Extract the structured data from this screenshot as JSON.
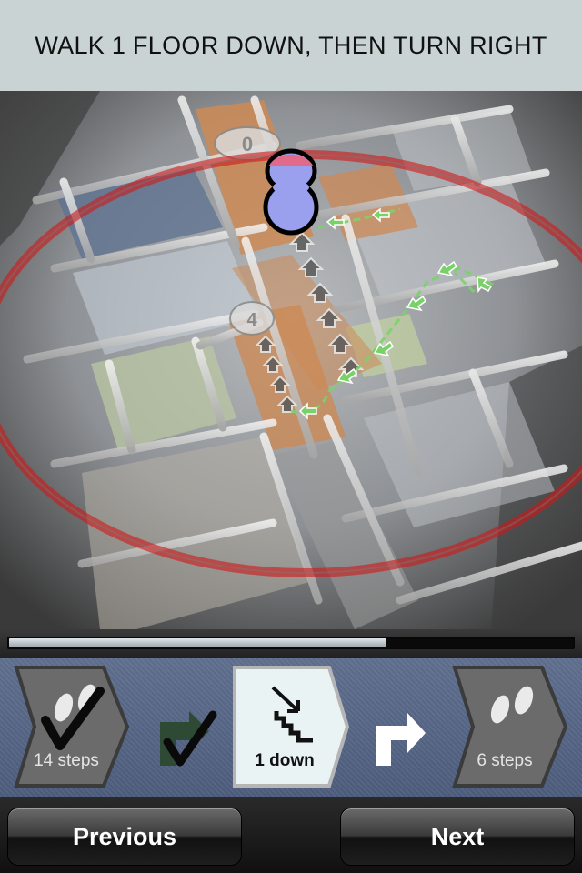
{
  "header": {
    "instruction": "WALK 1 FLOOR DOWN, THEN TURN RIGHT"
  },
  "map": {
    "room_numbers": [
      "0",
      "4"
    ],
    "colors": {
      "corridor": "#cc8a55",
      "route_to_do": "#6a6a6a",
      "route_other": "#7ad16a",
      "user_marker": "#9aa0ee",
      "range_ring": "#d01818"
    }
  },
  "progress": {
    "value": 0.67
  },
  "steps": [
    {
      "label": "14 steps",
      "icon": "footprints-icon",
      "completed": true
    },
    {
      "label": "",
      "icon": "turn-left-arrow-icon",
      "completed": true
    },
    {
      "label": "1 down",
      "icon": "stairs-down-icon",
      "active": true
    },
    {
      "label": "",
      "icon": "turn-right-arrow-icon"
    },
    {
      "label": "6 steps",
      "icon": "footprints-icon"
    }
  ],
  "nav": {
    "previous_label": "Previous",
    "next_label": "Next"
  }
}
